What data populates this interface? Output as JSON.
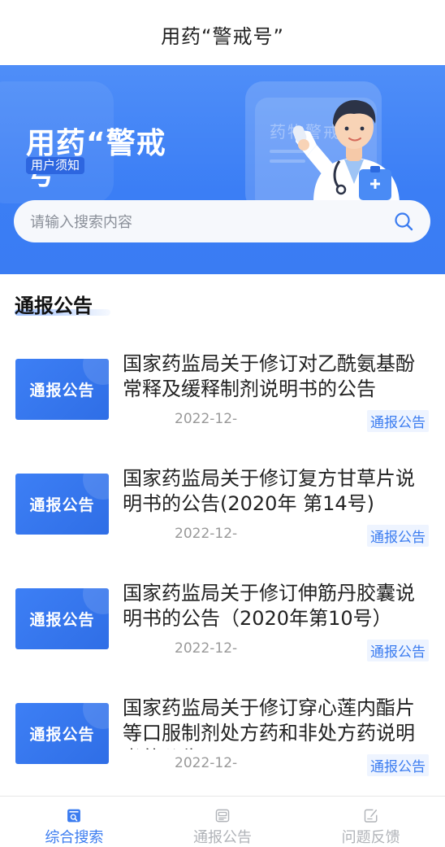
{
  "header": {
    "title": "用药“警戒号”"
  },
  "banner": {
    "heading": "用药“警戒号",
    "tag": "用户须知",
    "card_text": "药物警戒"
  },
  "search": {
    "placeholder": "请输入搜索内容",
    "icon": "search-icon"
  },
  "section": {
    "title": "通报公告"
  },
  "articles": [
    {
      "thumb": "通报公告",
      "title": "国家药监局关于修订对乙酰氨基酚常释及缓释制剂说明书的公告",
      "date": "2022-12-",
      "category": "通报公告"
    },
    {
      "thumb": "通报公告",
      "title": "国家药监局关于修订复方甘草片说明书的公告(2020年 第14号)",
      "date": "2022-12-",
      "category": "通报公告"
    },
    {
      "thumb": "通报公告",
      "title": "国家药监局关于修订伸筋丹胶囊说明书的公告（2020年第10号）",
      "date": "2022-12-",
      "category": "通报公告"
    },
    {
      "thumb": "通报公告",
      "title": "国家药监局关于修订穿心莲内酯片等口服制剂处方药和非处方药说明书的公告",
      "date": "2022-12-",
      "category": "通报公告"
    }
  ],
  "tabbar": {
    "tabs": [
      {
        "label": "综合搜索",
        "icon": "search-doc-icon",
        "active": true
      },
      {
        "label": "通报公告",
        "icon": "notice-icon",
        "active": false
      },
      {
        "label": "问题反馈",
        "icon": "feedback-icon",
        "active": false
      }
    ]
  },
  "colors": {
    "accent": "#3b7cf0",
    "banner": "#3a7cf3",
    "inactive": "#b0b3b8"
  }
}
